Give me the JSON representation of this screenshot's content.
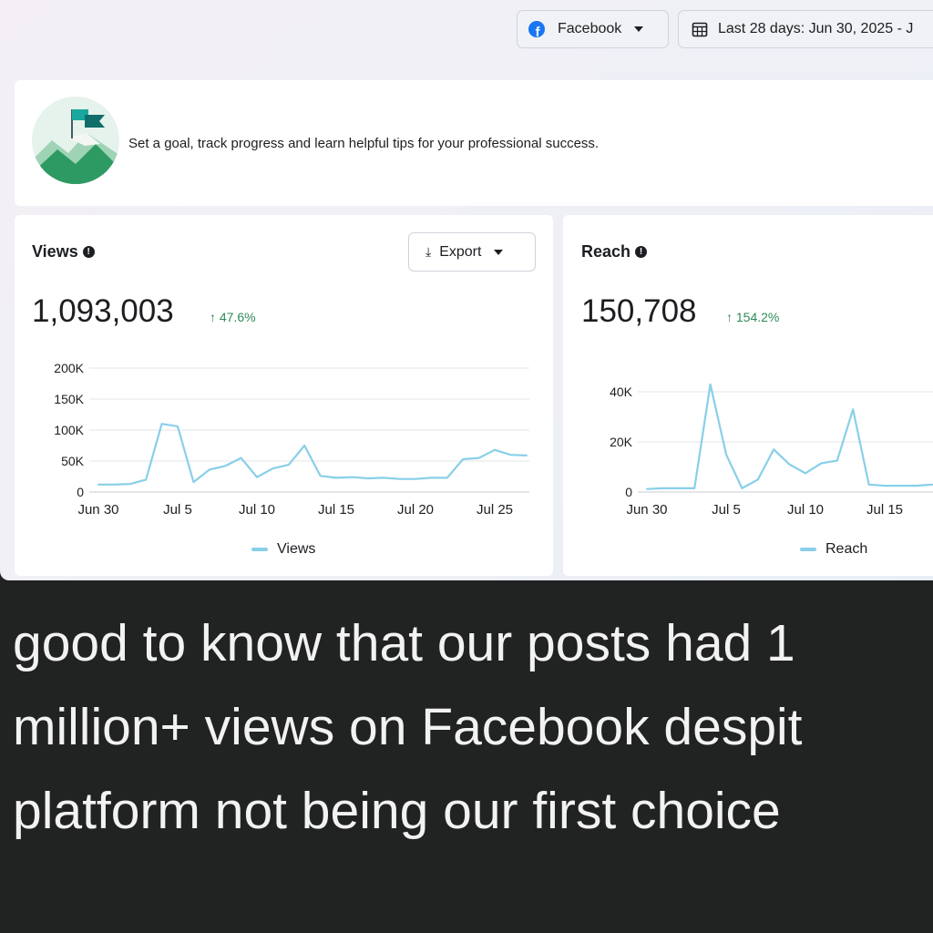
{
  "header": {
    "platform_label": "Facebook",
    "date_range_label": "Last 28 days: Jun 30, 2025 - J"
  },
  "goal_card": {
    "text": "Set a goal, track progress and learn helpful tips for your professional success."
  },
  "views_card": {
    "title": "Views",
    "value": "1,093,003",
    "delta": "↑ 47.6%",
    "export_label": "Export",
    "legend": "Views"
  },
  "reach_card": {
    "title": "Reach",
    "value": "150,708",
    "delta": "↑ 154.2%",
    "legend": "Reach"
  },
  "caption": {
    "lines": [
      "good to know that our posts had 1",
      "million+ views on Facebook despit",
      "platform not being our first choice"
    ]
  },
  "colors": {
    "line": "#89cfe8",
    "positive": "#2e8a57",
    "facebook_blue": "#1877f2"
  },
  "icons": {
    "platform": "facebook-logo-icon",
    "date": "calendar-icon",
    "export": "download-icon",
    "info": "info-icon"
  },
  "chart_data": [
    {
      "type": "line",
      "title": "Views",
      "series": [
        {
          "name": "Views",
          "x": [
            "Jun 30",
            "Jul 1",
            "Jul 2",
            "Jul 3",
            "Jul 4",
            "Jul 5",
            "Jul 6",
            "Jul 7",
            "Jul 8",
            "Jul 9",
            "Jul 10",
            "Jul 11",
            "Jul 12",
            "Jul 13",
            "Jul 14",
            "Jul 15",
            "Jul 16",
            "Jul 17",
            "Jul 18",
            "Jul 19",
            "Jul 20",
            "Jul 21",
            "Jul 22",
            "Jul 23",
            "Jul 24",
            "Jul 25",
            "Jul 26",
            "Jul 27"
          ],
          "values": [
            12000,
            12000,
            13000,
            20000,
            110000,
            106000,
            16000,
            36000,
            42000,
            55000,
            24000,
            38000,
            44000,
            75000,
            26000,
            23000,
            24000,
            22000,
            23000,
            21000,
            21000,
            23000,
            23000,
            53000,
            55000,
            68000,
            60000,
            59000
          ]
        }
      ],
      "x_ticks": [
        "Jun 30",
        "Jul 5",
        "Jul 10",
        "Jul 15",
        "Jul 20",
        "Jul 25"
      ],
      "y_ticks": [
        "0",
        "50K",
        "100K",
        "150K",
        "200K"
      ],
      "ylim": [
        0,
        200000
      ],
      "grid": true,
      "legend": "bottom-center"
    },
    {
      "type": "line",
      "title": "Reach",
      "series": [
        {
          "name": "Reach",
          "x": [
            "Jun 30",
            "Jul 1",
            "Jul 2",
            "Jul 3",
            "Jul 4",
            "Jul 5",
            "Jul 6",
            "Jul 7",
            "Jul 8",
            "Jul 9",
            "Jul 10",
            "Jul 11",
            "Jul 12",
            "Jul 13",
            "Jul 14",
            "Jul 15",
            "Jul 16",
            "Jul 17",
            "Jul 18"
          ],
          "values": [
            1200,
            1500,
            1500,
            1500,
            43000,
            15000,
            1500,
            5000,
            17000,
            11000,
            7500,
            11500,
            12500,
            33000,
            3000,
            2500,
            2500,
            2500,
            3000
          ]
        }
      ],
      "x_ticks": [
        "Jun 30",
        "Jul 5",
        "Jul 10",
        "Jul 15"
      ],
      "y_ticks": [
        "0",
        "20K",
        "40K"
      ],
      "ylim": [
        0,
        50000
      ],
      "grid": true,
      "legend": "bottom-center"
    }
  ]
}
